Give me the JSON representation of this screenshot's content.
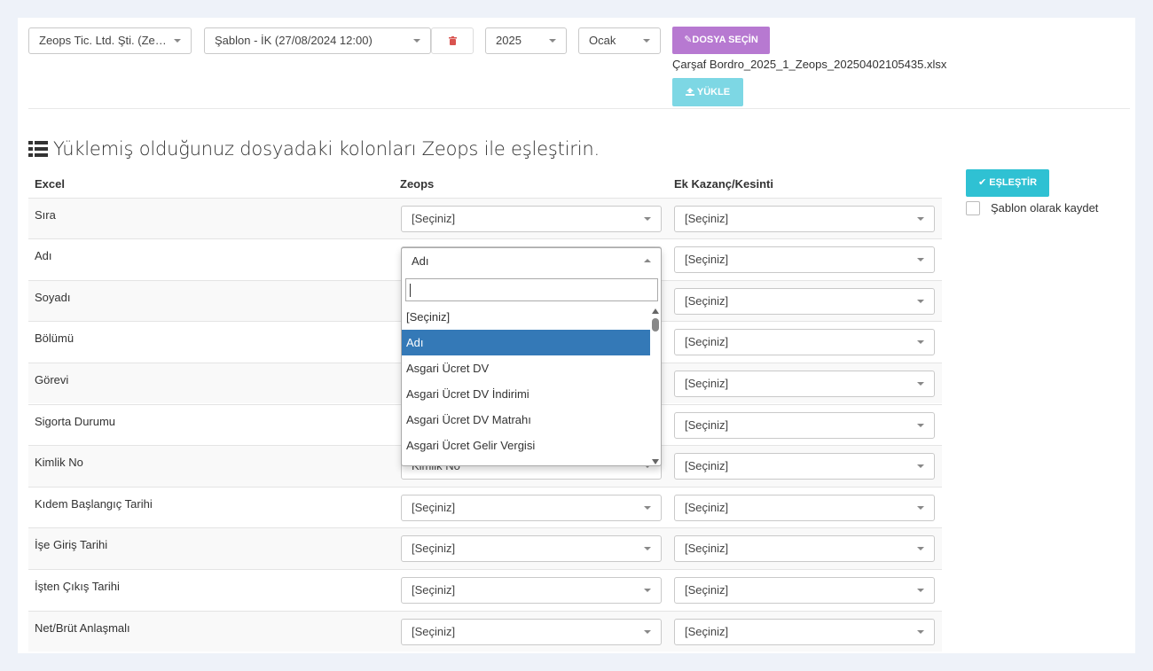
{
  "toolbar": {
    "company": "Zeops Tic. Ltd. Şti. (Zeo...",
    "template": "Şablon - İK (27/08/2024 12:00)",
    "year": "2025",
    "month": "Ocak",
    "file_button": "DOSYA SEÇİN",
    "filename": "Çarşaf Bordro_2025_1_Zeops_20250402105435.xlsx",
    "upload_button": "YÜKLE"
  },
  "heading": "Yüklemiş olduğunuz dosyadaki kolonları Zeops ile eşleştirin.",
  "table": {
    "headers": [
      "Excel",
      "Zeops",
      "Ek Kazanç/Kesinti"
    ],
    "rows": [
      {
        "excel": "Sıra",
        "zeops": "[Seçiniz]",
        "ek": "[Seçiniz]"
      },
      {
        "excel": "Adı",
        "zeops": "Adı",
        "ek": "[Seçiniz]"
      },
      {
        "excel": "Soyadı",
        "zeops": "",
        "ek": "[Seçiniz]"
      },
      {
        "excel": "Bölümü",
        "zeops": "",
        "ek": "[Seçiniz]"
      },
      {
        "excel": "Görevi",
        "zeops": "",
        "ek": "[Seçiniz]"
      },
      {
        "excel": "Sigorta Durumu",
        "zeops": "",
        "ek": "[Seçiniz]"
      },
      {
        "excel": "Kimlik No",
        "zeops": "Kimlik No",
        "ek": "[Seçiniz]"
      },
      {
        "excel": "Kıdem Başlangıç Tarihi",
        "zeops": "[Seçiniz]",
        "ek": "[Seçiniz]"
      },
      {
        "excel": "İşe Giriş Tarihi",
        "zeops": "[Seçiniz]",
        "ek": "[Seçiniz]"
      },
      {
        "excel": "İşten Çıkış Tarihi",
        "zeops": "[Seçiniz]",
        "ek": "[Seçiniz]"
      },
      {
        "excel": "Net/Brüt Anlaşmalı",
        "zeops": "[Seçiniz]",
        "ek": "[Seçiniz]"
      }
    ]
  },
  "dropdown": {
    "selected": "Adı",
    "search_value": "",
    "options": [
      "[Seçiniz]",
      "Adı",
      "Asgari Ücret DV",
      "Asgari Ücret DV İndirimi",
      "Asgari Ücret DV Matrahı",
      "Asgari Ücret Gelir Vergisi"
    ],
    "highlighted_index": 1
  },
  "actions": {
    "match_button": "EŞLEŞTİR",
    "save_template_label": "Şablon olarak kaydet",
    "save_template_checked": false
  },
  "colors": {
    "file_button": "#b779d1",
    "upload_button": "#7dd7e4",
    "match_button": "#2fc1d3",
    "highlight": "#3479b7",
    "trash_icon": "#d9534f"
  },
  "icons": {
    "trash": "trash-icon",
    "file": "paperclip-icon",
    "upload": "upload-icon",
    "list": "list-icon",
    "check": "check-icon"
  }
}
